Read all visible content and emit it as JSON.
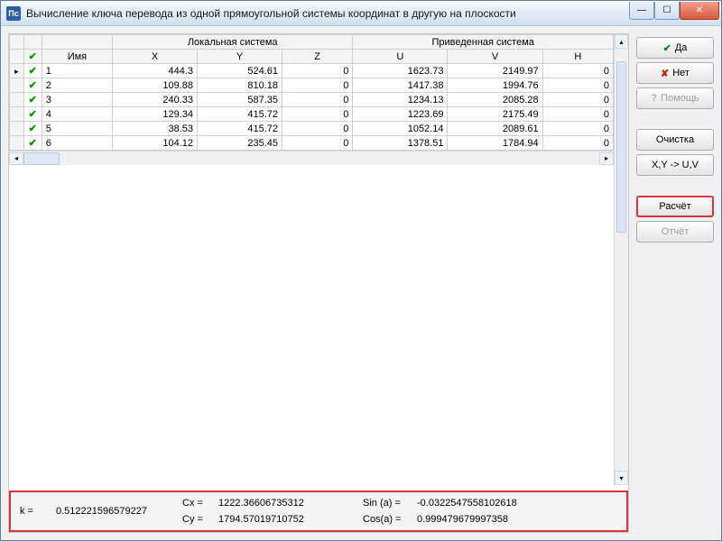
{
  "window": {
    "title": "Вычисление ключа перевода из одной прямоугольной системы координат в другую на плоскости"
  },
  "grid": {
    "group_local": "Локальная система",
    "group_target": "Приведенная система",
    "cols": {
      "name": "Имя",
      "x": "X",
      "y": "Y",
      "z": "Z",
      "u": "U",
      "v": "V",
      "h": "H"
    },
    "rows": [
      {
        "n": "1",
        "x": "444.3",
        "y": "524.61",
        "z": "0",
        "u": "1623.73",
        "v": "2149.97",
        "h": "0"
      },
      {
        "n": "2",
        "x": "109.88",
        "y": "810.18",
        "z": "0",
        "u": "1417.38",
        "v": "1994.76",
        "h": "0"
      },
      {
        "n": "3",
        "x": "240.33",
        "y": "587.35",
        "z": "0",
        "u": "1234.13",
        "v": "2085.28",
        "h": "0"
      },
      {
        "n": "4",
        "x": "129.34",
        "y": "415.72",
        "z": "0",
        "u": "1223.69",
        "v": "2175.49",
        "h": "0"
      },
      {
        "n": "5",
        "x": "38.53",
        "y": "415.72",
        "z": "0",
        "u": "1052.14",
        "v": "2089.61",
        "h": "0"
      },
      {
        "n": "6",
        "x": "104.12",
        "y": "235.45",
        "z": "0",
        "u": "1378.51",
        "v": "1784.94",
        "h": "0"
      }
    ]
  },
  "buttons": {
    "yes": "Да",
    "no": "Нет",
    "help": "Помощь",
    "clear": "Очистка",
    "convert": "X,Y -> U,V",
    "calc": "Расчёт",
    "report": "Отчёт"
  },
  "results": {
    "cx_label": "Cx =",
    "cx": "1222.36606735312",
    "cy_label": "Cy =",
    "cy": "1794.57019710752",
    "k_label": "k =",
    "k": "0.512221596579227",
    "sin_label": "Sin (a) =",
    "sin": "-0.0322547558102618",
    "cos_label": "Cos(a) =",
    "cos": "0.999479679997358"
  }
}
